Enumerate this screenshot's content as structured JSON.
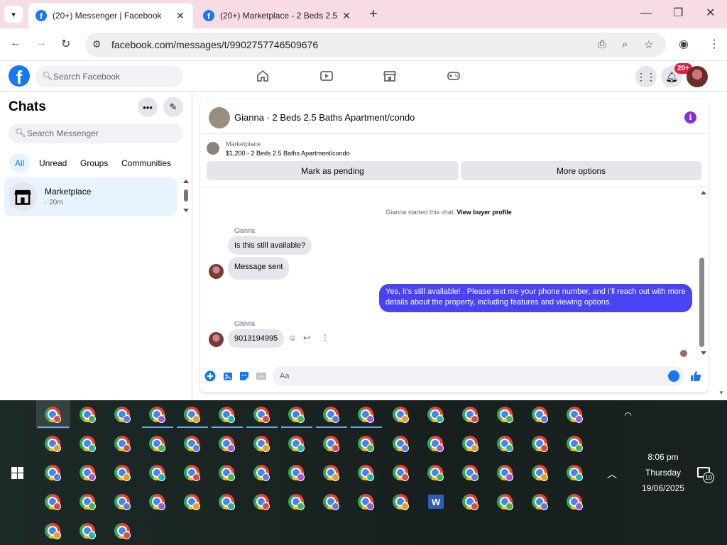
{
  "browser": {
    "tabs": [
      {
        "title": "(20+) Messenger | Facebook",
        "active": true
      },
      {
        "title": "(20+) Marketplace - 2 Beds 2.5",
        "active": false
      }
    ],
    "url": "facebook.com/messages/t/9902757746509676"
  },
  "fb_header": {
    "search_placeholder": "Search Facebook",
    "notification_badge": "20+",
    "accent": "#1877f2"
  },
  "sidebar": {
    "title": "Chats",
    "search_placeholder": "Search Messenger",
    "filters": [
      "All",
      "Unread",
      "Groups",
      "Communities"
    ],
    "selected_filter": "All",
    "conversations": [
      {
        "name": "Marketplace",
        "time": "· 20m"
      }
    ]
  },
  "chat": {
    "title": "Gianna · 2 Beds 2.5 Baths Apartment/condo",
    "listing": {
      "label": "Marketplace",
      "detail": "$1,200 - 2 Beds 2.5 Baths Apartment/condo"
    },
    "buttons": {
      "pending": "Mark as pending",
      "more": "More options"
    },
    "system_message": "Gianna started this chat.",
    "system_link": "View buyer profile",
    "messages": [
      {
        "sender": "Gianna",
        "text": "Is this still available?"
      },
      {
        "text": "Message sent"
      },
      {
        "mine": true,
        "text": "Yes, it's still available! . Please text me your phone number, and I'll reach out with more details about the property, including features and viewing options."
      },
      {
        "sender": "Gianna",
        "text": "9013194995"
      }
    ],
    "composer_placeholder": "Aa",
    "my_bubble_color": "#4a42f5"
  },
  "taskbar": {
    "time": "8:06 pm",
    "day": "Thursday",
    "date": "19/06/2025",
    "notification_count": "10",
    "word_letter": "W"
  }
}
